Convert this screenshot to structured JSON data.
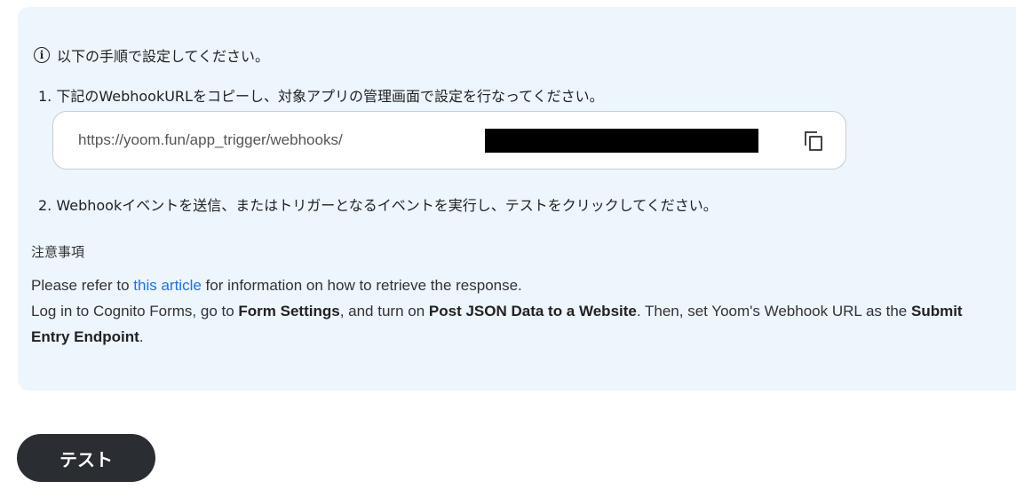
{
  "panel": {
    "info_text": "以下の手順で設定してください。",
    "step1": "1. 下記のWebhookURLをコピーし、対象アプリの管理画面で設定を行なってください。",
    "webhook_url": "https://yoom.fun/app_trigger/webhooks/",
    "step2": "2. Webhookイベントを送信、またはトリガーとなるイベントを実行し、テストをクリックしてください。",
    "notes_title": "注意事項",
    "notes": {
      "line1_prefix": "Please refer to ",
      "line1_link": "this article",
      "line1_suffix": " for information on how to retrieve the response.",
      "line2_a": "Log in to Cognito Forms, go to ",
      "line2_b": "Form Settings",
      "line2_c": ", and turn on ",
      "line2_d": "Post JSON Data to a Website",
      "line2_e": ". Then, set Yoom's Webhook URL as the ",
      "line2_f": "Submit Entry Endpoint",
      "line2_g": "."
    }
  },
  "test_button": {
    "label": "テスト"
  },
  "colors": {
    "panel_bg": "#edf5fd",
    "link": "#1a73e8",
    "button_bg": "#2a2d31"
  }
}
